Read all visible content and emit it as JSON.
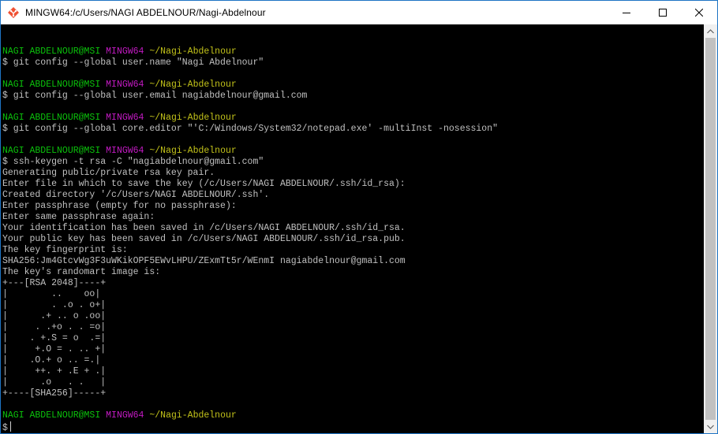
{
  "window": {
    "title": "MINGW64:/c/Users/NAGI ABDELNOUR/Nagi-Abdelnour",
    "icon": "git-bash-icon",
    "controls": {
      "minimize": "minimize-icon",
      "maximize": "maximize-icon",
      "close": "close-icon"
    }
  },
  "colors": {
    "user_host": "#0bc10b",
    "shell_name": "#c31ac3",
    "path": "#c3c31a",
    "text": "#c0c0c0",
    "background": "#000000"
  },
  "terminal": {
    "lines": [
      {
        "type": "blank"
      },
      {
        "type": "prompt",
        "user": "NAGI ABDELNOUR@MSI",
        "shell": "MINGW64",
        "path": "~/Nagi-Abdelnour"
      },
      {
        "type": "text",
        "text": "$ git config --global user.name \"Nagi Abdelnour\""
      },
      {
        "type": "blank"
      },
      {
        "type": "prompt",
        "user": "NAGI ABDELNOUR@MSI",
        "shell": "MINGW64",
        "path": "~/Nagi-Abdelnour"
      },
      {
        "type": "text",
        "text": "$ git config --global user.email nagiabdelnour@gmail.com"
      },
      {
        "type": "blank"
      },
      {
        "type": "prompt",
        "user": "NAGI ABDELNOUR@MSI",
        "shell": "MINGW64",
        "path": "~/Nagi-Abdelnour"
      },
      {
        "type": "text",
        "text": "$ git config --global core.editor \"'C:/Windows/System32/notepad.exe' -multiInst -nosession\""
      },
      {
        "type": "blank"
      },
      {
        "type": "prompt",
        "user": "NAGI ABDELNOUR@MSI",
        "shell": "MINGW64",
        "path": "~/Nagi-Abdelnour"
      },
      {
        "type": "text",
        "text": "$ ssh-keygen -t rsa -C \"nagiabdelnour@gmail.com\""
      },
      {
        "type": "text",
        "text": "Generating public/private rsa key pair."
      },
      {
        "type": "text",
        "text": "Enter file in which to save the key (/c/Users/NAGI ABDELNOUR/.ssh/id_rsa):"
      },
      {
        "type": "text",
        "text": "Created directory '/c/Users/NAGI ABDELNOUR/.ssh'."
      },
      {
        "type": "text",
        "text": "Enter passphrase (empty for no passphrase):"
      },
      {
        "type": "text",
        "text": "Enter same passphrase again:"
      },
      {
        "type": "text",
        "text": "Your identification has been saved in /c/Users/NAGI ABDELNOUR/.ssh/id_rsa."
      },
      {
        "type": "text",
        "text": "Your public key has been saved in /c/Users/NAGI ABDELNOUR/.ssh/id_rsa.pub."
      },
      {
        "type": "text",
        "text": "The key fingerprint is:"
      },
      {
        "type": "text",
        "text": "SHA256:Jm4GtcvWg3F3uWKikOPF5EWvLHPU/ZExmTt5r/WEnmI nagiabdelnour@gmail.com"
      },
      {
        "type": "text",
        "text": "The key's randomart image is:"
      },
      {
        "type": "text",
        "text": "+---[RSA 2048]----+"
      },
      {
        "type": "text",
        "text": "|        ..    oo|"
      },
      {
        "type": "text",
        "text": "|        . .o . o+|"
      },
      {
        "type": "text",
        "text": "|      .+ .. o .oo|"
      },
      {
        "type": "text",
        "text": "|     . .+o . . =o|"
      },
      {
        "type": "text",
        "text": "|    . +.S = o  .=|"
      },
      {
        "type": "text",
        "text": "|     +.O = . .. +|"
      },
      {
        "type": "text",
        "text": "|    .O.+ o .. =.|"
      },
      {
        "type": "text",
        "text": "|     ++. + .E + .|"
      },
      {
        "type": "text",
        "text": "|      .o   . .   |"
      },
      {
        "type": "text",
        "text": "+----[SHA256]-----+"
      },
      {
        "type": "blank"
      },
      {
        "type": "prompt",
        "user": "NAGI ABDELNOUR@MSI",
        "shell": "MINGW64",
        "path": "~/Nagi-Abdelnour"
      },
      {
        "type": "input",
        "text": "$"
      }
    ]
  },
  "scrollbar": {
    "up": "scroll-up-arrow-icon",
    "down": "scroll-down-arrow-icon"
  }
}
